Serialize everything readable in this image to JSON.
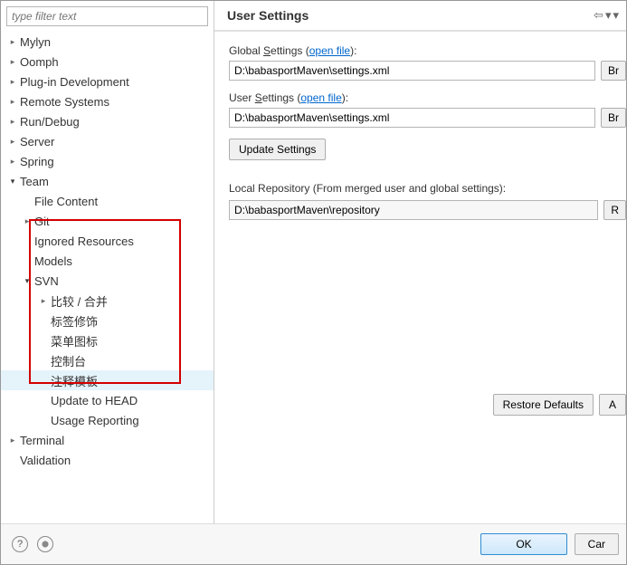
{
  "filter": {
    "placeholder": "type filter text"
  },
  "tree": {
    "mylyn": "Mylyn",
    "oomph": "Oomph",
    "plugin_dev": "Plug-in Development",
    "remote": "Remote Systems",
    "rundebug": "Run/Debug",
    "server": "Server",
    "spring": "Spring",
    "team": "Team",
    "file_content": "File Content",
    "git": "Git",
    "ignored": "Ignored Resources",
    "models": "Models",
    "svn": "SVN",
    "svn_compare": "比较 / 合并",
    "svn_label_dec": "标签修饰",
    "svn_menu_icon": "菜单图标",
    "svn_console": "控制台",
    "svn_templates": "注释模板",
    "svn_update_head": "Update to HEAD",
    "svn_usage": "Usage Reporting",
    "terminal": "Terminal",
    "validation": "Validation"
  },
  "header": {
    "title": "User Settings"
  },
  "form": {
    "global_label_pre": "Global ",
    "global_label_u": "S",
    "global_label_post": "ettings (",
    "open_file": "open file",
    "close_paren": "):",
    "global_value": "D:\\babasportMaven\\settings.xml",
    "browse": "Br",
    "user_label_pre": "User ",
    "user_label_u": "S",
    "user_label_post": "ettings (",
    "user_value": "D:\\babasportMaven\\settings.xml",
    "update_btn": "Update Settings",
    "local_repo_label": "Local Repository (From merged user and global settings):",
    "local_repo_value": "D:\\babasportMaven\\repository",
    "reindex": "R",
    "restore_defaults": "Restore Defaults",
    "apply": "A"
  },
  "footer": {
    "help": "?",
    "ok": "OK",
    "cancel": "Car"
  }
}
